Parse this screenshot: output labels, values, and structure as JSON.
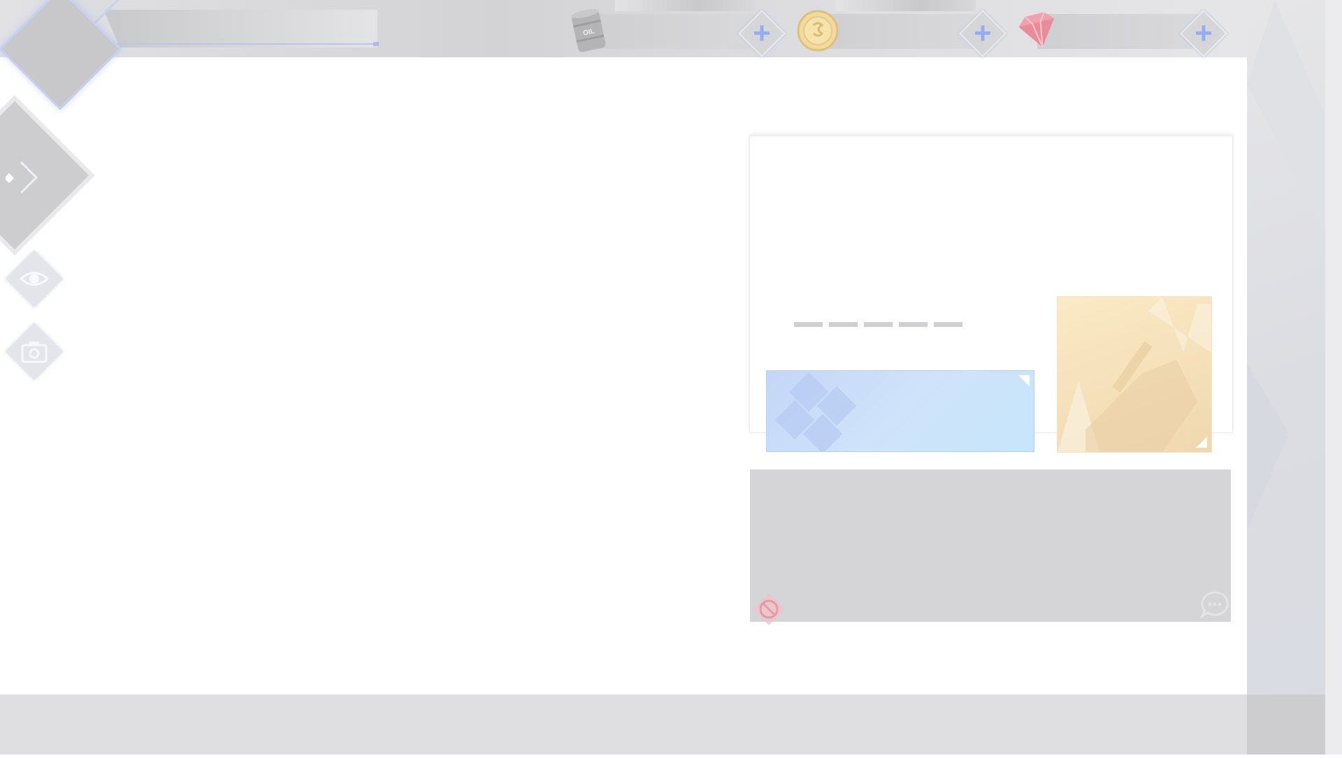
{
  "hud": {
    "player": {
      "avatar": "commander-avatar",
      "level_bar": "exp-bar"
    },
    "resources": [
      {
        "icon": "oil-barrel-icon",
        "icon_text": "OIL",
        "add_icon": "plus-icon"
      },
      {
        "icon": "gold-coin-icon",
        "add_icon": "plus-icon"
      },
      {
        "icon": "gem-icon",
        "add_icon": "plus-icon"
      }
    ]
  },
  "sidebar": {
    "items": [
      {
        "icon": "expand-arrow-icon"
      },
      {
        "icon": "eye-icon"
      },
      {
        "icon": "camera-icon"
      }
    ]
  },
  "panel": {
    "placeholder_dashes": 5,
    "cards": [
      {
        "name": "blue-card",
        "color": "#c9ddf9"
      },
      {
        "name": "yellow-card",
        "color": "#f6e3bd"
      }
    ]
  },
  "chat": {
    "icons": [
      "block-icon",
      "chat-bubble-icon"
    ]
  },
  "colors": {
    "accent": "#93adf0",
    "panel_gray": "#d5d5d7",
    "block_red": "#e79aa6"
  }
}
